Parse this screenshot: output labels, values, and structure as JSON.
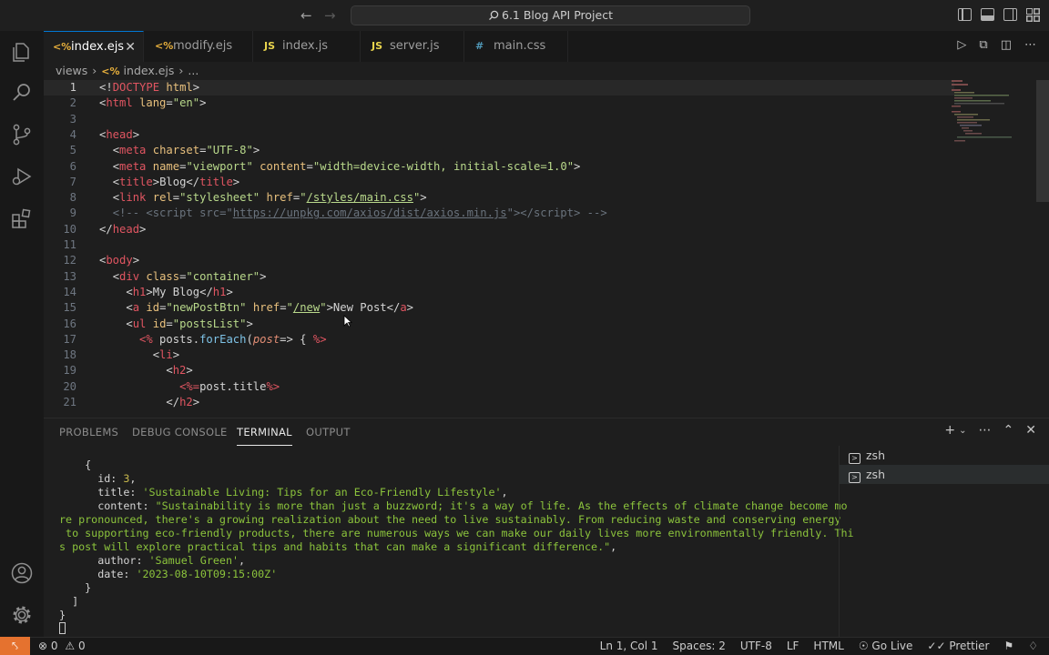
{
  "titlebar": {
    "back_icon": "arrow-left-icon",
    "forward_icon": "arrow-right-icon",
    "search_text": "6.1 Blog API Project"
  },
  "activity": [
    "files-icon",
    "search-icon",
    "source-control-icon",
    "run-debug-icon",
    "extensions-icon",
    "account-icon",
    "gear-icon"
  ],
  "tabs": [
    {
      "label": "index.ejs",
      "type": "ejs",
      "active": true
    },
    {
      "label": "modify.ejs",
      "type": "ejs"
    },
    {
      "label": "index.js",
      "type": "js"
    },
    {
      "label": "server.js",
      "type": "js"
    },
    {
      "label": "main.css",
      "type": "css"
    }
  ],
  "breadcrumb": {
    "folder": "views",
    "file": "index.ejs",
    "more": "..."
  },
  "editor": {
    "line_numbers": [
      "1",
      "2",
      "3",
      "4",
      "5",
      "6",
      "7",
      "8",
      "9",
      "10",
      "11",
      "12",
      "13",
      "14",
      "15",
      "16",
      "17",
      "18",
      "19",
      "20",
      "21"
    ]
  },
  "panel": {
    "tabs": [
      "PROBLEMS",
      "DEBUG CONSOLE",
      "TERMINAL",
      "OUTPUT"
    ],
    "active_tab": "TERMINAL",
    "terminal_lines": [
      "    {",
      "      id: 3,",
      "      title: 'Sustainable Living: Tips for an Eco-Friendly Lifestyle',",
      "      content: \"Sustainability is more than just a buzzword; it's a way of life. As the effects of climate change become mo",
      "re pronounced, there's a growing realization about the need to live sustainably. From reducing waste and conserving energy",
      " to supporting eco-friendly products, there are numerous ways we can make our daily lives more environmentally friendly. Thi",
      "s post will explore practical tips and habits that can make a significant difference.\",",
      "      author: 'Samuel Green',",
      "      date: '2023-08-10T09:15:00Z'",
      "    }",
      "  ]",
      "}"
    ],
    "terminals": [
      "zsh",
      "zsh"
    ]
  },
  "statusbar": {
    "errors": "0",
    "warnings": "0",
    "position": "Ln 1, Col 1",
    "spaces": "Spaces: 2",
    "encoding": "UTF-8",
    "eol": "LF",
    "language": "HTML",
    "go_live": "Go Live",
    "prettier": "Prettier"
  }
}
